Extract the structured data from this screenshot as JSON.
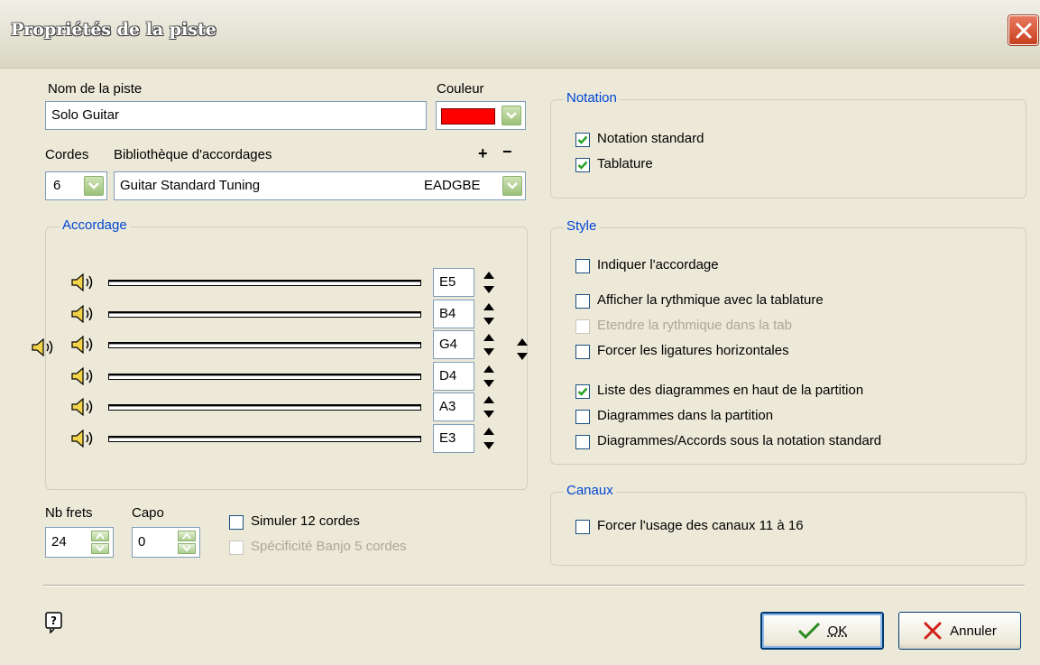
{
  "window": {
    "title": "Propriétés de la piste"
  },
  "track": {
    "name_label": "Nom de la piste",
    "name_value": "Solo Guitar",
    "color_label": "Couleur",
    "color_value": "#ff0000"
  },
  "strings": {
    "label": "Cordes",
    "value": "6"
  },
  "tuning_library": {
    "label": "Bibliothèque d'accordages",
    "plus": "+",
    "minus": "−",
    "name": "Guitar Standard Tuning",
    "notes": "EADGBE"
  },
  "accordage": {
    "legend": "Accordage",
    "rows": [
      {
        "note": "E5"
      },
      {
        "note": "B4"
      },
      {
        "note": "G4"
      },
      {
        "note": "D4"
      },
      {
        "note": "A3"
      },
      {
        "note": "E3"
      }
    ]
  },
  "frets": {
    "label": "Nb frets",
    "value": "24"
  },
  "capo": {
    "label": "Capo",
    "value": "0"
  },
  "options": {
    "simulate12": {
      "label": "Simuler 12 cordes",
      "checked": false
    },
    "banjo5": {
      "label": "Spécificité Banjo 5 cordes",
      "checked": false,
      "disabled": true
    }
  },
  "notation": {
    "legend": "Notation",
    "standard": {
      "label": "Notation standard",
      "checked": true
    },
    "tab": {
      "label": "Tablature",
      "checked": true
    }
  },
  "style": {
    "legend": "Style",
    "items": [
      {
        "label": "Indiquer l'accordage",
        "checked": false
      },
      {
        "label": "Afficher la rythmique avec la tablature",
        "checked": false
      },
      {
        "label": "Etendre la rythmique dans la tab",
        "checked": false,
        "disabled": true
      },
      {
        "label": "Forcer les ligatures horizontales",
        "checked": false
      },
      {
        "label": "Liste des diagrammes en haut de la partition",
        "checked": true
      },
      {
        "label": "Diagrammes dans la partition",
        "checked": false
      },
      {
        "label": "Diagrammes/Accords sous la notation standard",
        "checked": false
      }
    ]
  },
  "canaux": {
    "legend": "Canaux",
    "force": {
      "label": "Forcer l'usage des canaux 11 à 16",
      "checked": false
    }
  },
  "buttons": {
    "ok": "OK",
    "cancel": "Annuler"
  },
  "colors": {
    "accent": "#0046d5",
    "ok_check": "#2b8a1f",
    "cancel_x": "#d2231a"
  }
}
